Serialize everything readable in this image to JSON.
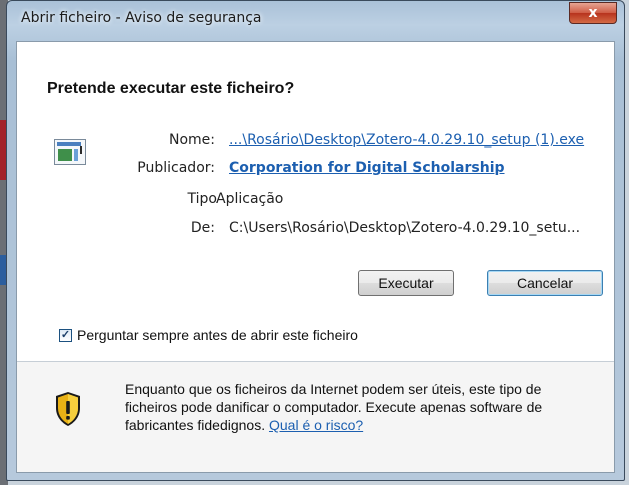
{
  "window": {
    "title": "Abrir ficheiro - Aviso de segurança",
    "close_symbol": "x"
  },
  "dialog": {
    "heading": "Pretende executar este ficheiro?",
    "fields": {
      "name_label": "Nome:",
      "name_value": "...\\Rosário\\Desktop\\Zotero-4.0.29.10_setup (1).exe",
      "publisher_label": "Publicador:",
      "publisher_value": "Corporation for Digital Scholarship",
      "type_label": "Tipo",
      "type_value": "Aplicação",
      "from_label": "De:",
      "from_value": "C:\\Users\\Rosário\\Desktop\\Zotero-4.0.29.10_setu..."
    },
    "buttons": {
      "run": "Executar",
      "cancel": "Cancelar"
    },
    "checkbox": {
      "label": "Perguntar sempre antes de abrir este ficheiro",
      "checked": true,
      "mark": "✓"
    },
    "warning": {
      "text": "Enquanto que os ficheiros da Internet podem ser úteis, este tipo de ficheiros pode danificar o computador. Execute apenas software de fabricantes fidedignos.",
      "link": "Qual é o risco?",
      "icon": "security-shield-icon"
    }
  },
  "colors": {
    "link": "#1c5fb0",
    "close_button": "#c8402a",
    "shield": "#e9b115"
  }
}
